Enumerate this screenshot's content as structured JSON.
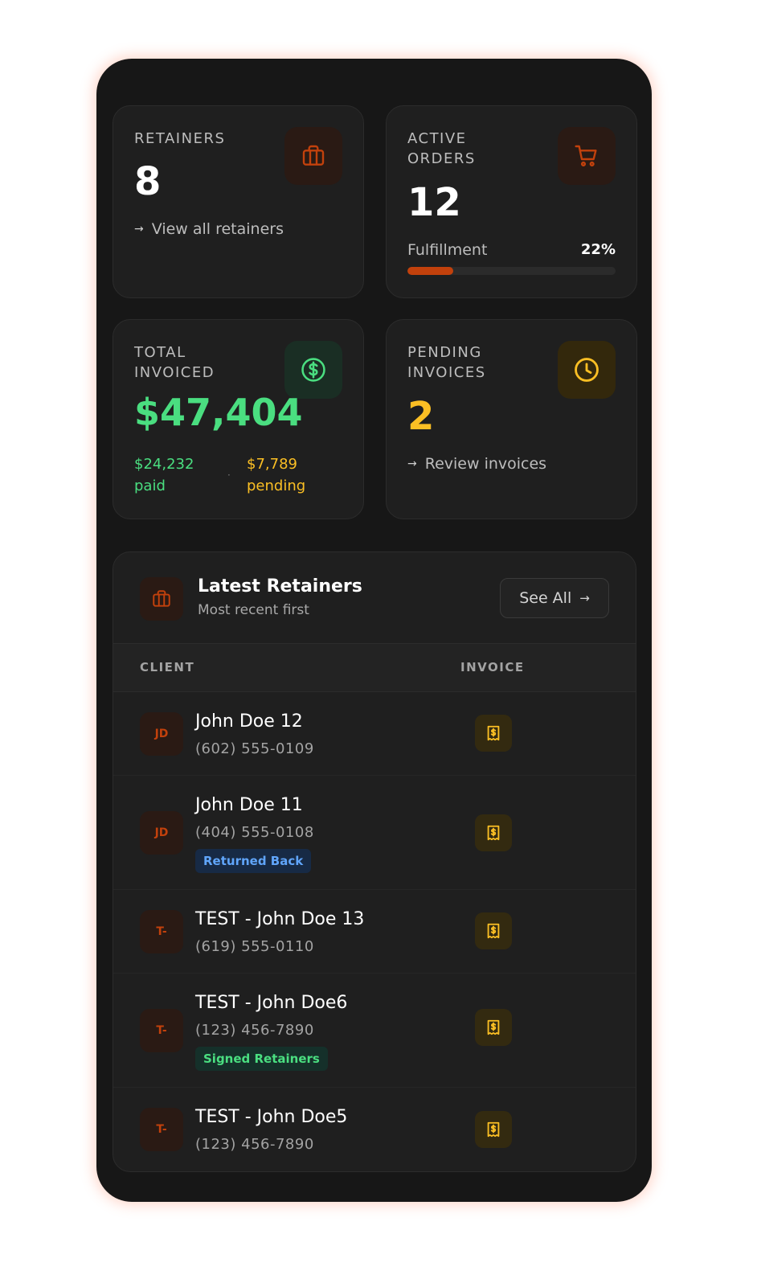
{
  "colors": {
    "background": "#171717",
    "card": "#1f1f1f",
    "accent_orange": "#c2410c",
    "accent_green": "#4ade80",
    "accent_yellow": "#fbbf24",
    "accent_blue": "#60a5fa"
  },
  "stats": {
    "retainers": {
      "label": "RETAINERS",
      "value": "8",
      "link": "View all retainers",
      "icon": "briefcase-icon"
    },
    "active_orders": {
      "label": "ACTIVE ORDERS",
      "value": "12",
      "progress_label": "Fulfillment",
      "progress_pct_text": "22%",
      "progress_fraction": 0.22,
      "icon": "cart-icon"
    },
    "total_invoiced": {
      "label": "TOTAL INVOICED",
      "value": "$47,404",
      "paid_amount": "$24,232",
      "paid_word": "paid",
      "pending_amount": "$7,789",
      "pending_word": "pending",
      "separator": "·",
      "icon": "dollar-circle-icon"
    },
    "pending_invoices": {
      "label": "PENDING INVOICES",
      "value": "2",
      "link": "Review invoices",
      "icon": "clock-icon"
    }
  },
  "latest": {
    "title": "Latest Retainers",
    "subtitle": "Most recent first",
    "see_all": "See All",
    "columns": {
      "client": "CLIENT",
      "invoice": "INVOICE"
    },
    "rows": [
      {
        "initials": "JD",
        "name": "John Doe 12",
        "phone": "(602) 555-0109",
        "badge": null
      },
      {
        "initials": "JD",
        "name": "John Doe 11",
        "phone": "(404) 555-0108",
        "badge": {
          "text": "Returned Back",
          "style": "blue"
        }
      },
      {
        "initials": "T-",
        "name": "TEST - John Doe 13",
        "phone": "(619) 555-0110",
        "badge": null
      },
      {
        "initials": "T-",
        "name": "TEST - John Doe6",
        "phone": "(123) 456-7890",
        "badge": {
          "text": "Signed Retainers",
          "style": "green"
        }
      },
      {
        "initials": "T-",
        "name": "TEST - John Doe5",
        "phone": "(123) 456-7890",
        "badge": null
      }
    ]
  }
}
